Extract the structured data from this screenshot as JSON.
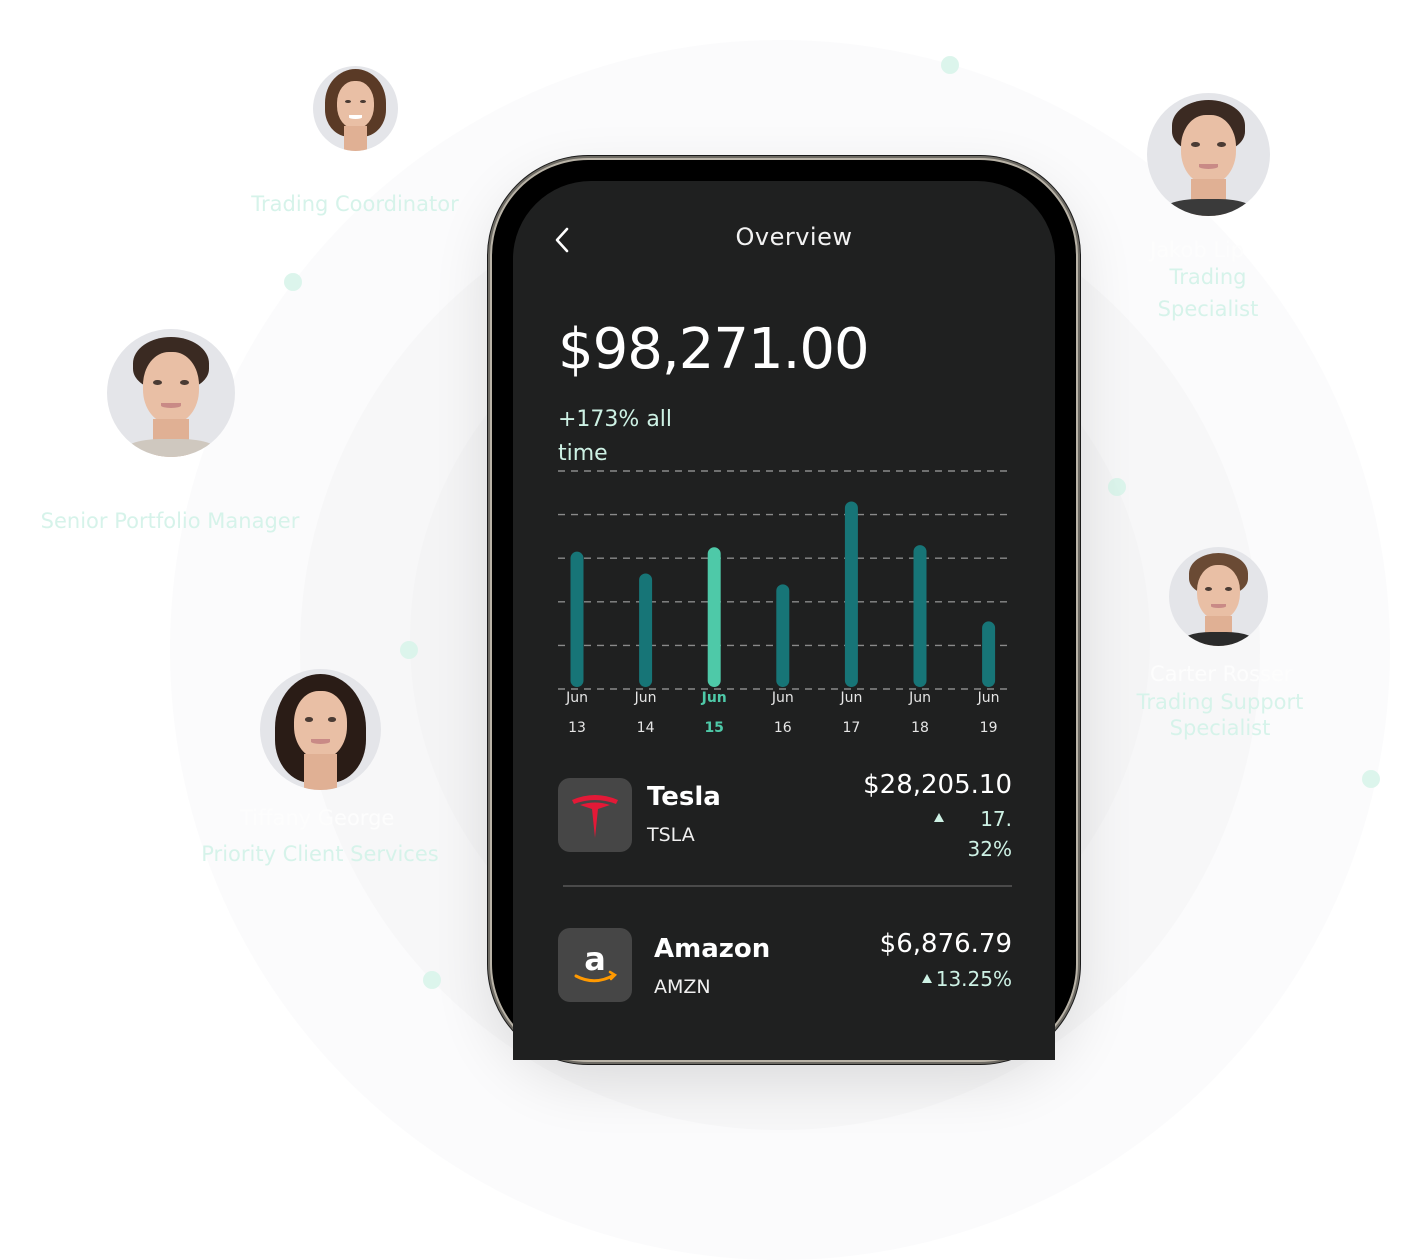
{
  "team": [
    {
      "name": "",
      "role": "Trading Coordinator",
      "avatar_hair": "#5a3a26",
      "avatar_shirt": "#6b4a3a"
    },
    {
      "name": "Jakob Lip",
      "role_lines": [
        "Trading",
        "Specialist"
      ],
      "avatar_hair": "#3b2a22",
      "avatar_shirt": "#3a3a3a"
    },
    {
      "name": "",
      "role": "Senior Portfolio Manager",
      "avatar_hair": "#3a2a22",
      "avatar_shirt": "#cfc8bf"
    },
    {
      "name": "Carter Rosser",
      "role_lines": [
        "Trading Support",
        "Specialist"
      ],
      "avatar_hair": "#6a4a34",
      "avatar_shirt": "#2b2b2b"
    },
    {
      "name": "Tiffany George",
      "role": "Priority Client Services",
      "avatar_hair": "#2a1c16",
      "avatar_shirt": "#2a1c16"
    }
  ],
  "app": {
    "title": "Overview",
    "back_icon": "chevron-left-icon",
    "balance": "$98,271.00",
    "growth_line1": "+173% all",
    "growth_line2": "time"
  },
  "chart_data": {
    "type": "bar",
    "title": "",
    "xlabel": "",
    "ylabel": "",
    "ylim": [
      0,
      5
    ],
    "grid": true,
    "categories": [
      {
        "month": "Jun",
        "day": "13"
      },
      {
        "month": "Jun",
        "day": "14"
      },
      {
        "month": "Jun",
        "day": "15"
      },
      {
        "month": "Jun",
        "day": "16"
      },
      {
        "month": "Jun",
        "day": "17"
      },
      {
        "month": "Jun",
        "day": "18"
      },
      {
        "month": "Jun",
        "day": "19"
      }
    ],
    "values": [
      3.15,
      2.65,
      3.25,
      2.4,
      4.3,
      3.3,
      1.55
    ],
    "highlight_index": 2,
    "colors": {
      "bar": "#177577",
      "highlight": "#4ec9a8",
      "grid": "#8a8a8a"
    }
  },
  "stocks": [
    {
      "name": "Tesla",
      "ticker": "TSLA",
      "price": "$28,205.10",
      "change_line1": "17.",
      "change_line2": "32%",
      "direction": "up",
      "logo": "tesla-logo",
      "logo_color": "#e31937"
    },
    {
      "name": "Amazon",
      "ticker": "AMZN",
      "price": "$6,876.79",
      "change": "13.25%",
      "direction": "up",
      "logo": "amazon-logo",
      "logo_color": "#ff9900"
    }
  ]
}
